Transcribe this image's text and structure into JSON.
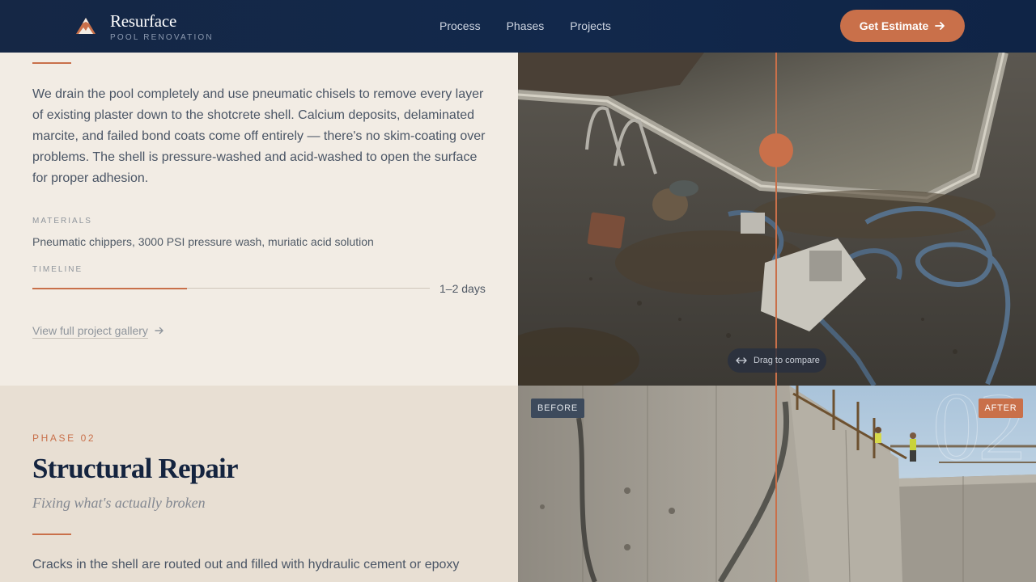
{
  "header": {
    "brand_name": "Resurface",
    "brand_sub": "POOL RENOVATION",
    "logo_icon": "mountain-peak-icon",
    "nav": [
      "Process",
      "Phases",
      "Projects"
    ],
    "cta_label": "Get Estimate"
  },
  "phase1": {
    "description": "We drain the pool completely and use pneumatic chisels to remove every layer of existing plaster down to the shotcrete shell. Calcium deposits, delaminated marcite, and failed bond coats come off entirely — there's no skim-coating over problems. The shell is pressure-washed and acid-washed to open the surface for proper adhesion.",
    "materials_label": "MATERIALS",
    "materials": "Pneumatic chippers, 3000 PSI pressure wash, muriatic acid solution",
    "timeline_label": "TIMELINE",
    "timeline_value": "1–2 days",
    "timeline_progress_fraction": 0.39,
    "gallery_link": "View full project gallery",
    "compare_hint": "Drag to compare"
  },
  "phase2": {
    "kicker": "PHASE 02",
    "title": "Structural Repair",
    "subtitle": "Fixing what's actually broken",
    "description": "Cracks in the shell are routed out and filled with hydraulic cement or epoxy",
    "tag_before": "BEFORE",
    "tag_after": "AFTER",
    "ghost_number": "02"
  },
  "colors": {
    "accent": "#c9704a",
    "navy": "#12284b",
    "panel_light": "#f2ece4",
    "panel_beige": "#e8dfd3"
  }
}
